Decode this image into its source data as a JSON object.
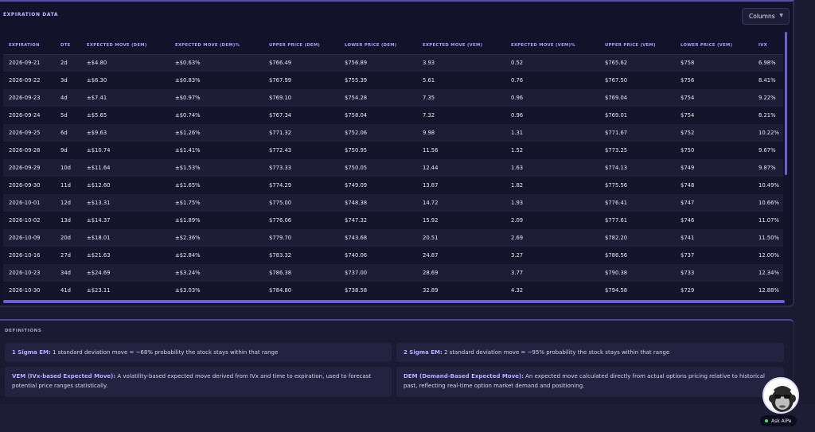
{
  "panel": {
    "title": "EXPIRATION DATA",
    "columns_button": "Columns"
  },
  "table": {
    "headers": [
      "EXPIRATION",
      "DTE",
      "EXPECTED MOVE (DEM)",
      "EXPECTED MOVE (DEM)%",
      "UPPER PRICE (DEM)",
      "LOWER PRICE (DEM)",
      "EXPECTED MOVE (VEM)",
      "EXPECTED MOVE (VEM)%",
      "UPPER PRICE (VEM)",
      "LOWER PRICE (VEM)",
      "IVX"
    ],
    "rows": [
      [
        "2026-09-21",
        "2d",
        "±$4.80",
        "±$0.63%",
        "$766.49",
        "$756.89",
        "3.93",
        "0.52",
        "$765.62",
        "$758",
        "6.98%"
      ],
      [
        "2026-09-22",
        "3d",
        "±$6.30",
        "±$0.83%",
        "$767.99",
        "$755.39",
        "5.61",
        "0.76",
        "$767.50",
        "$756",
        "8.41%"
      ],
      [
        "2026-09-23",
        "4d",
        "±$7.41",
        "±$0.97%",
        "$769.10",
        "$754.28",
        "7.35",
        "0.96",
        "$769.04",
        "$754",
        "9.22%"
      ],
      [
        "2026-09-24",
        "5d",
        "±$5.65",
        "±$0.74%",
        "$767.34",
        "$758.04",
        "7.32",
        "0.96",
        "$769.01",
        "$754",
        "8.21%"
      ],
      [
        "2026-09-25",
        "6d",
        "±$9.63",
        "±$1.26%",
        "$771.32",
        "$752.06",
        "9.98",
        "1.31",
        "$771.67",
        "$752",
        "10.22%"
      ],
      [
        "2026-09-28",
        "9d",
        "±$10.74",
        "±$1.41%",
        "$772.43",
        "$750.95",
        "11.56",
        "1.52",
        "$773.25",
        "$750",
        "9.67%"
      ],
      [
        "2026-09-29",
        "10d",
        "±$11.64",
        "±$1.53%",
        "$773.33",
        "$750.05",
        "12.44",
        "1.63",
        "$774.13",
        "$749",
        "9.87%"
      ],
      [
        "2026-09-30",
        "11d",
        "±$12.60",
        "±$1.65%",
        "$774.29",
        "$749.09",
        "13.87",
        "1.82",
        "$775.56",
        "$748",
        "10.49%"
      ],
      [
        "2026-10-01",
        "12d",
        "±$13.31",
        "±$1.75%",
        "$775.00",
        "$748.38",
        "14.72",
        "1.93",
        "$776.41",
        "$747",
        "10.66%"
      ],
      [
        "2026-10-02",
        "13d",
        "±$14.37",
        "±$1.89%",
        "$776.06",
        "$747.32",
        "15.92",
        "2.09",
        "$777.61",
        "$746",
        "11.07%"
      ],
      [
        "2026-10-09",
        "20d",
        "±$18.01",
        "±$2.36%",
        "$779.70",
        "$743.68",
        "20.51",
        "2.69",
        "$782.20",
        "$741",
        "11.50%"
      ],
      [
        "2026-10-16",
        "27d",
        "±$21.63",
        "±$2.84%",
        "$783.32",
        "$740.06",
        "24.87",
        "3.27",
        "$786.56",
        "$737",
        "12.00%"
      ],
      [
        "2026-10-23",
        "34d",
        "±$24.69",
        "±$3.24%",
        "$786.38",
        "$737.00",
        "28.69",
        "3.77",
        "$790.38",
        "$733",
        "12.34%"
      ],
      [
        "2026-10-30",
        "41d",
        "±$23.11",
        "±$3.03%",
        "$784.80",
        "$738.58",
        "32.89",
        "4.32",
        "$794.58",
        "$729",
        "12.88%"
      ]
    ]
  },
  "definitions": {
    "title": "DEFINITIONS",
    "items": [
      {
        "term": "1 Sigma EM:",
        "text": " 1 standard deviation move = ~68% probability the stock stays within that range"
      },
      {
        "term": "2 Sigma EM:",
        "text": " 2 standard deviation move = ~95% probability the stock stays within that range"
      },
      {
        "term": "VEM (IVx-based Expected Move):",
        "text": " A volatility-based expected move derived from IVx and time to expiration, used to forecast potential price ranges statistically."
      },
      {
        "term": "DEM (Demand-Based Expected Move):",
        "text": " An expected move calculated directly from actual options pricing relative to historical past, reflecting real-time option market demand and positioning."
      }
    ]
  },
  "assistant": {
    "label": "Ask AiPe",
    "status_color": "#3ee08a"
  },
  "colors": {
    "accent": "#a99cff",
    "panel": "#13122a",
    "page": "#1b1a30"
  }
}
